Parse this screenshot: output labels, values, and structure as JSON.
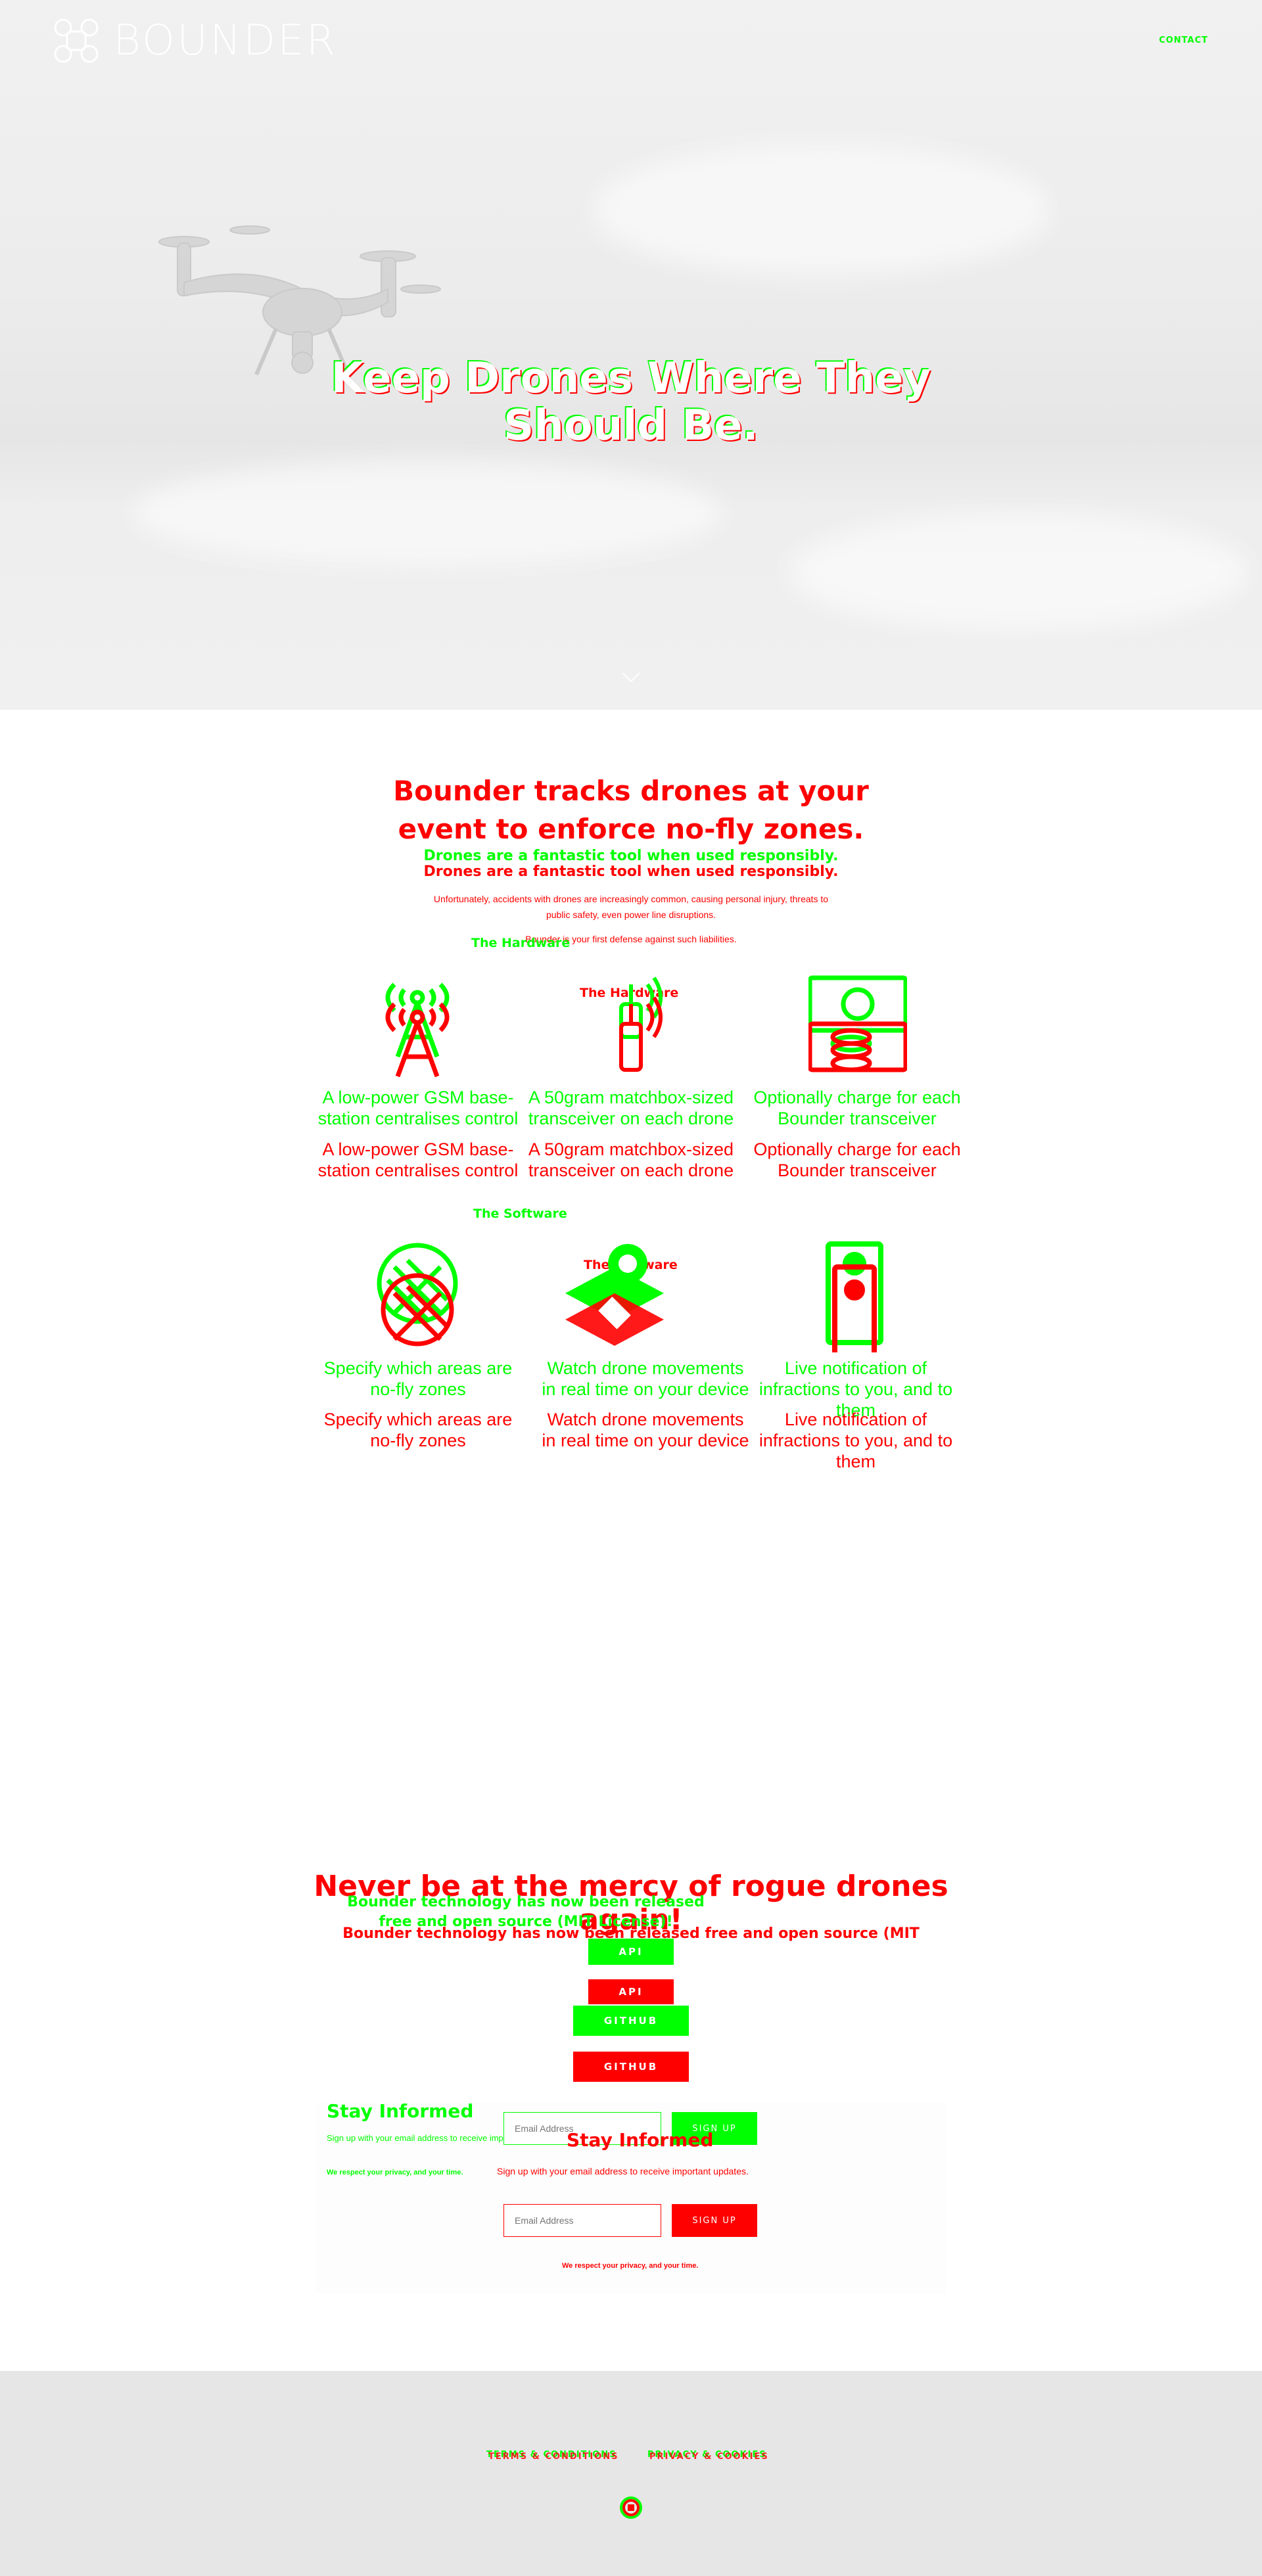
{
  "header": {
    "logo_text": "BOUNDER",
    "nav_contact": "CONTACT"
  },
  "hero": {
    "title": "Keep Drones Where They Should Be."
  },
  "intro": {
    "title": "Bounder tracks drones at your event to enforce no-fly zones.",
    "subtitle": "Drones are a fantastic tool when used responsibly.",
    "body": "Unfortunately, accidents with drones are increasingly common, causing personal injury, threats to public safety, even power line disruptions.",
    "body2": "Bounder is your first defense against such liabilities."
  },
  "hardware": {
    "heading": "The Hardware",
    "items": [
      {
        "text": "A low-power GSM base-station centralises control",
        "icon": "cell-tower-icon"
      },
      {
        "text": "A 50gram matchbox-sized transceiver on each drone",
        "icon": "transceiver-icon"
      },
      {
        "text": "Optionally charge for each Bounder transceiver",
        "icon": "money-icon"
      }
    ]
  },
  "software": {
    "heading": "The Software",
    "items": [
      {
        "text": "Specify which areas are no-fly zones",
        "icon": "map-zone-icon"
      },
      {
        "text": "Watch drone movements in real time on your device",
        "icon": "map-pin-icon"
      },
      {
        "text": "Live notification of infractions to you, and to them",
        "icon": "phone-alert-icon"
      }
    ]
  },
  "opensource": {
    "title": "Never be at the mercy of rogue drones again!",
    "subtitle": "Bounder technology has now been released free and open source (MIT License)!",
    "api_label": "API",
    "github_label": "GITHUB"
  },
  "newsletter": {
    "title": "Stay Informed",
    "text": "Sign up with your email address to receive important updates.",
    "placeholder": "Email Address",
    "button_label": "SIGN UP",
    "privacy": "We respect your privacy, and your time."
  },
  "footer": {
    "terms": "TERMS & CONDITIONS",
    "privacy": "PRIVACY & COOKIES"
  },
  "colors": {
    "accent_green": "#00ff00",
    "accent_red": "#ff0000",
    "footer_bg": "#e6e6e6"
  }
}
